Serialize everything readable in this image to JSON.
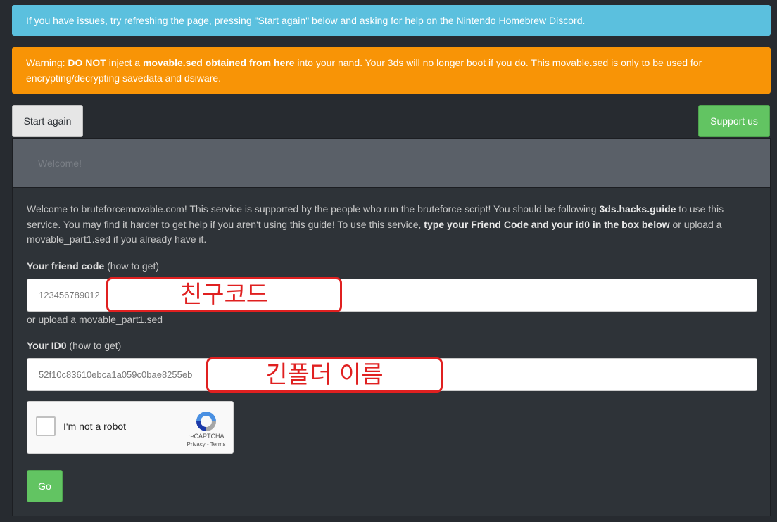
{
  "info_alert": {
    "text_before": "If you have issues, try refreshing the page, pressing \"Start again\" below and asking for help on the ",
    "link_text": "Nintendo Homebrew Discord",
    "text_after": "."
  },
  "warning_alert": {
    "prefix": "Warning: ",
    "bold1": "DO NOT",
    "text1": " inject a ",
    "bold2": "movable.sed obtained from here",
    "text2": " into your nand. Your 3ds will no longer boot if you do. This movable.sed is only to be used for encrypting/decrypting savedata and dsiware."
  },
  "toolbar": {
    "start_again_label": "Start again",
    "support_label": "Support us"
  },
  "panel": {
    "heading": "Welcome!",
    "intro_text1": "Welcome to bruteforcemovable.com! This service is supported by the people who run the bruteforce script! You should be following ",
    "intro_bold1": "3ds.hacks.guide",
    "intro_text2": " to use this service. You may find it harder to get help if you aren't using this guide! To use this service, ",
    "intro_bold2": "type your Friend Code and your id0 in the box below",
    "intro_text3": " or upload a movable_part1.sed if you already have it."
  },
  "friend_code": {
    "label_bold": "Your friend code",
    "label_hint": " (how to get)",
    "value": "123456789012",
    "annotation": "친구코드"
  },
  "upload_link": "or upload a movable_part1.sed",
  "id0": {
    "label_bold": "Your ID0",
    "label_hint": " (how to get)",
    "value": "52f10c83610ebca1a059c0bae8255eb",
    "annotation": "긴폴더 이름"
  },
  "captcha": {
    "checkbox_label": "I'm not a robot",
    "brand": "reCAPTCHA",
    "terms": "Privacy - Terms"
  },
  "go_label": "Go",
  "colors": {
    "info": "#5bc0de",
    "warning": "#f89406",
    "success": "#62c462",
    "background": "#272b30",
    "annotation": "#e02020"
  }
}
